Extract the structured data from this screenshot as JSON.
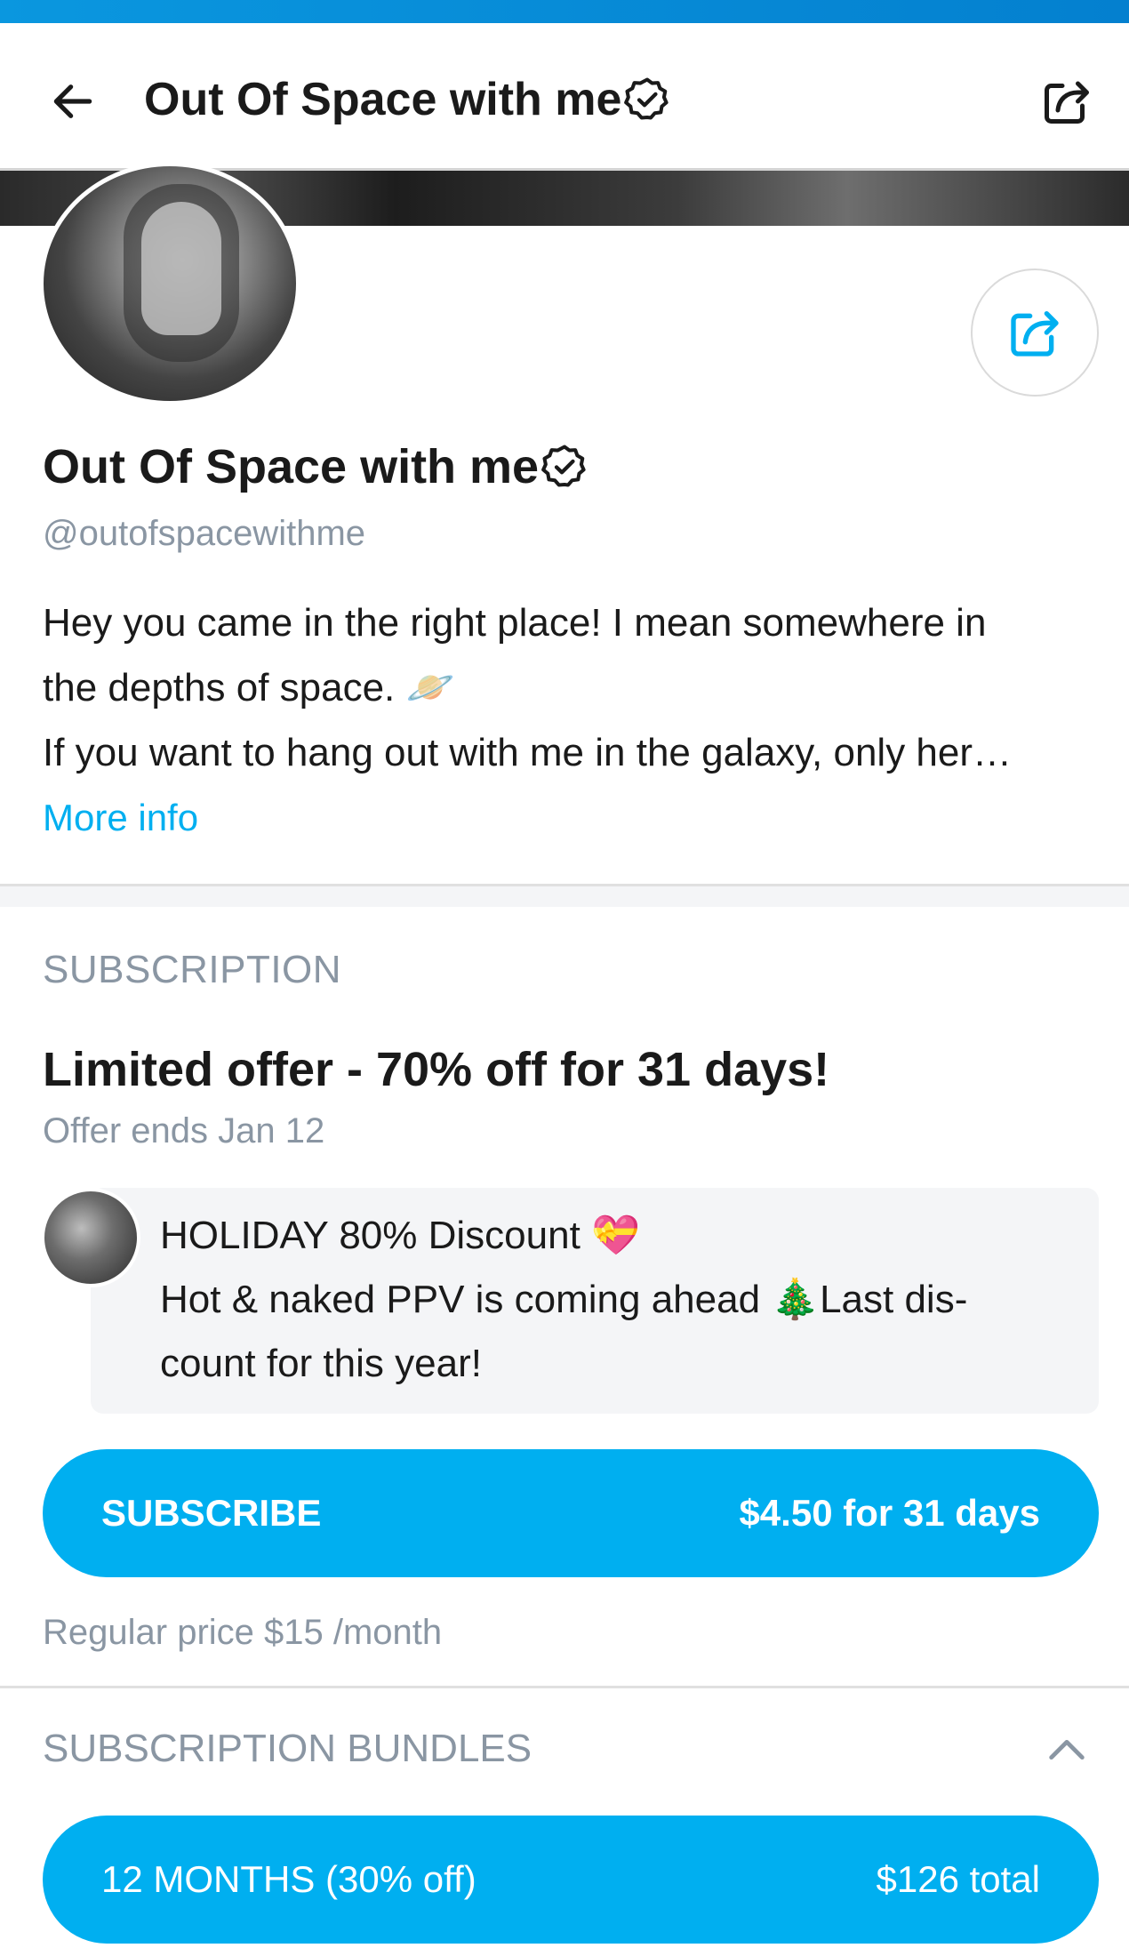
{
  "colors": {
    "accent": "#00aff0",
    "muted": "#8a96a3",
    "top_strip": "#0a97df",
    "message_bg": "#f4f5f7"
  },
  "header": {
    "title": "Out Of Space with me",
    "back_icon": "arrow-left-icon",
    "share_icon": "share-icon",
    "verified_icon": "verified-badge-icon"
  },
  "profile": {
    "name": "Out Of Space with me",
    "handle": "@outofspacewithme",
    "bio_lines": [
      "Hey you came in the right place! I mean somewhere in",
      "the depths of space. 🪐",
      "If you want to hang out with me in the galaxy, only her…"
    ],
    "more_info": "More info",
    "share_icon": "share-icon"
  },
  "subscription": {
    "heading": "SUBSCRIPTION",
    "offer_title": "Limited offer - 70% off for 31 days!",
    "offer_ends": "Offer ends Jan 12",
    "message_lines": [
      "HOLIDAY 80% Discount 💝",
      "Hot & naked PPV is coming ahead 🎄Last dis-",
      "count for this year!"
    ],
    "button_label": "SUBSCRIBE",
    "button_price": "$4.50 for 31 days",
    "regular_price": "Regular price $15 /month"
  },
  "bundles": {
    "heading": "SUBSCRIPTION BUNDLES",
    "collapse_icon": "chevron-up-icon",
    "items": [
      {
        "label": "12 MONTHS (30% off)",
        "price": "$126 total"
      }
    ]
  }
}
